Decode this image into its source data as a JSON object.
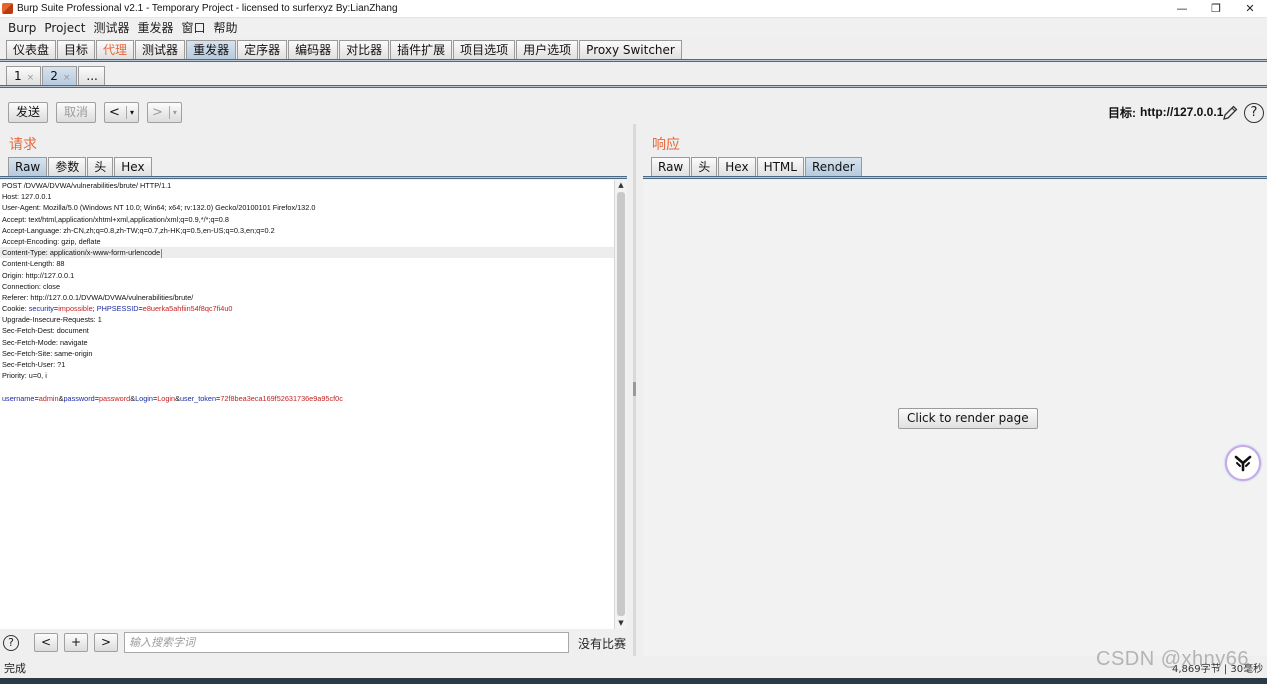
{
  "window": {
    "title": "Burp Suite Professional v2.1 - Temporary Project - licensed to surferxyz By:LianZhang",
    "minimize": "—",
    "maximize": "❐",
    "close": "✕"
  },
  "menu": [
    "Burp",
    "Project",
    "测试器",
    "重发器",
    "窗口",
    "帮助"
  ],
  "main_tabs": [
    "仪表盘",
    "目标",
    "代理",
    "测试器",
    "重发器",
    "定序器",
    "编码器",
    "对比器",
    "插件扩展",
    "项目选项",
    "用户选项",
    "Proxy Switcher"
  ],
  "sub_tabs": {
    "tab1": "1",
    "tab2": "2",
    "close": "×",
    "more": "..."
  },
  "toolbar": {
    "send": "发送",
    "cancel": "取消",
    "back": "<",
    "forward": ">",
    "dropdown": "▾"
  },
  "target": {
    "label": "目标:",
    "value": "http://127.0.0.1",
    "help": "?"
  },
  "request": {
    "title": "请求",
    "tabs": [
      "Raw",
      "参数",
      "头",
      "Hex"
    ],
    "lines": [
      "POST /DVWA/DVWA/vulnerabilities/brute/ HTTP/1.1",
      "Host: 127.0.0.1",
      "User-Agent: Mozilla/5.0 (Windows NT 10.0; Win64; x64; rv:132.0) Gecko/20100101 Firefox/132.0",
      "Accept: text/html,application/xhtml+xml,application/xml;q=0.9,*/*;q=0.8",
      "Accept-Language: zh-CN,zh;q=0.8,zh-TW;q=0.7,zh-HK;q=0.5,en-US;q=0.3,en;q=0.2",
      "Accept-Encoding: gzip, deflate",
      "Content-Type: application/x-www-form-urlencode",
      "Content-Length: 88",
      "Origin: http://127.0.0.1",
      "Connection: close",
      "Referer: http://127.0.0.1/DVWA/DVWA/vulnerabilities/brute/"
    ],
    "cookie": {
      "prefix": "Cookie: ",
      "k1": "security",
      "v1": "impossible",
      "k2": "PHPSESSID",
      "v2": "e8uerka5ahfiin54f8qc7fi4u0"
    },
    "lines2": [
      "Upgrade-Insecure-Requests: 1",
      "Sec-Fetch-Dest: document",
      "Sec-Fetch-Mode: navigate",
      "Sec-Fetch-Site: same-origin",
      "Sec-Fetch-User: ?1",
      "Priority: u=0, i"
    ],
    "body": {
      "k1": "username",
      "v1": "admin",
      "k2": "password",
      "v2": "password",
      "k3": "Login",
      "v3": "Login",
      "k4": "user_token",
      "v4": "72f8bea3eca169f52631736e9a95cf0c"
    },
    "eq": "=",
    "amp": "&",
    "semi": "; "
  },
  "response": {
    "title": "响应",
    "tabs": [
      "Raw",
      "头",
      "Hex",
      "HTML",
      "Render"
    ],
    "render_button": "Click to render page"
  },
  "search": {
    "help": "?",
    "prev": "<",
    "add": "+",
    "next": ">",
    "placeholder": "输入搜索字词",
    "matches": "没有比赛"
  },
  "status": {
    "text": "完成",
    "right": "4,869字节 | 30毫秒"
  },
  "watermark": "CSDN @xhny66",
  "icons": {
    "edit": "pencil-icon",
    "help": "help-icon",
    "float": "assistant-icon"
  }
}
